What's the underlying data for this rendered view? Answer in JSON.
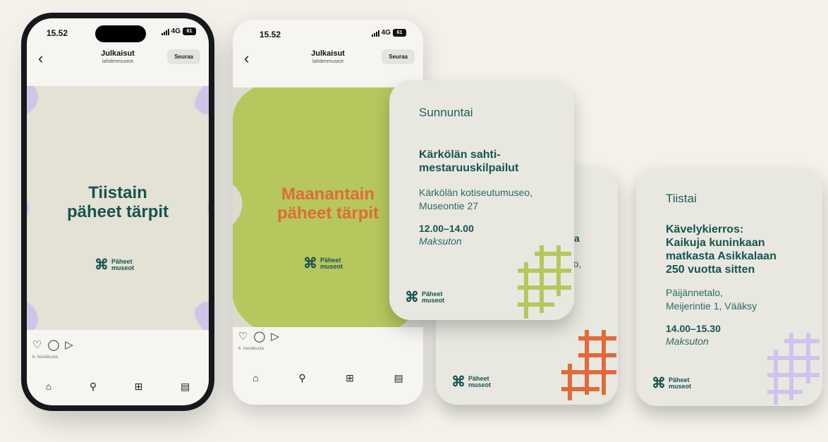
{
  "colors": {
    "teal": "#17544f",
    "orange": "#e06b3a",
    "lime": "#b6c75e",
    "lavender": "#cfc4ea",
    "bg": "#f3f1ea",
    "card": "#e8e8e1"
  },
  "phone1": {
    "time": "15.52",
    "network": "4G",
    "battery": "61",
    "back_icon": "chevron-left-icon",
    "title": "Julkaisut",
    "subtitle": "lahdenmuseot",
    "follow": "Seuraa",
    "headline_line1": "Tiistain",
    "headline_line2": "päheet tärpit",
    "logo_line1": "Päheet",
    "logo_line2": "museot",
    "date": "6. heinäkuuta",
    "actions": [
      "heart-icon",
      "comment-icon",
      "share-icon"
    ],
    "tabs": [
      "home-icon",
      "search-icon",
      "add-icon",
      "reels-icon"
    ]
  },
  "phone2": {
    "time": "15.52",
    "network": "4G",
    "battery": "61",
    "title": "Julkaisut",
    "subtitle": "lahdenmuseot",
    "follow": "Seuraa",
    "headline_line1": "Maanantain",
    "headline_line2": "päheet tärpit",
    "logo_line1": "Päheet",
    "logo_line2": "museot",
    "date": "6. heinäkuuta"
  },
  "card_sunday": {
    "day": "Sunnuntai",
    "event_line1": "Kärkölän sahti-",
    "event_line2": "mestaruuskilpailut",
    "venue_line1": "Kärkölän kotiseutumuseo,",
    "venue_line2": "Museontie 27",
    "hours": "12.00–14.00",
    "fee": "Maksuton",
    "logo_line1": "Päheet",
    "logo_line2": "museot"
  },
  "card_middle": {
    "fragment1": "a",
    "fragment2": "useo,",
    "logo_line1": "Päheet",
    "logo_line2": "museot"
  },
  "card_tuesday": {
    "day": "Tiistai",
    "event_line1": "Kävelykierros:",
    "event_line2": "Kaikuja kuninkaan",
    "event_line3": "matkasta Asikkalaan",
    "event_line4": "250 vuotta sitten",
    "venue_line1": "Päijännetalo,",
    "venue_line2": "Meijerintie 1, Vääksy",
    "hours": "14.00–15.30",
    "fee": "Maksuton",
    "logo_line1": "Päheet",
    "logo_line2": "museot"
  }
}
